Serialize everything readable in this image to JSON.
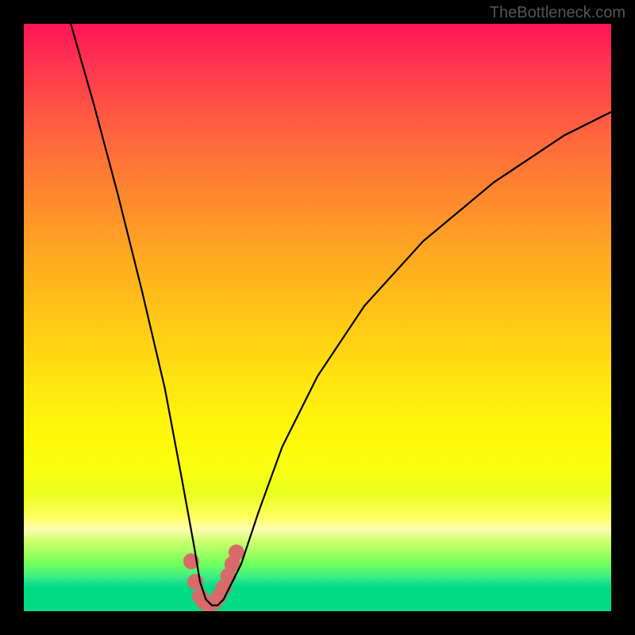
{
  "watermark": "TheBottleneck.com",
  "chart_data": {
    "type": "line",
    "title": "",
    "xlabel": "",
    "ylabel": "",
    "xlim": [
      0,
      100
    ],
    "ylim": [
      0,
      100
    ],
    "series": [
      {
        "name": "curve",
        "x": [
          8,
          12,
          16,
          20,
          24,
          27,
          29,
          30,
          31,
          32,
          33,
          34,
          35,
          37,
          40,
          44,
          50,
          58,
          68,
          80,
          92,
          100
        ],
        "y": [
          100,
          86,
          71,
          55,
          38,
          22,
          11,
          5,
          2,
          1,
          1,
          2,
          4,
          8,
          17,
          28,
          40,
          52,
          63,
          73,
          81,
          85
        ]
      }
    ],
    "markers": {
      "name": "highlight-band",
      "x": [
        28.5,
        29.2,
        30.0,
        30.8,
        31.6,
        32.4,
        33.2,
        34.0,
        34.8,
        35.5,
        36.2
      ],
      "y": [
        8.5,
        5.0,
        2.5,
        1.5,
        1.2,
        1.5,
        2.5,
        4.0,
        6.0,
        8.0,
        10.0
      ],
      "color": "#d86a6a",
      "radius": 10
    },
    "background_gradient": {
      "top": "#ff1456",
      "bottom": "#00db84"
    }
  }
}
